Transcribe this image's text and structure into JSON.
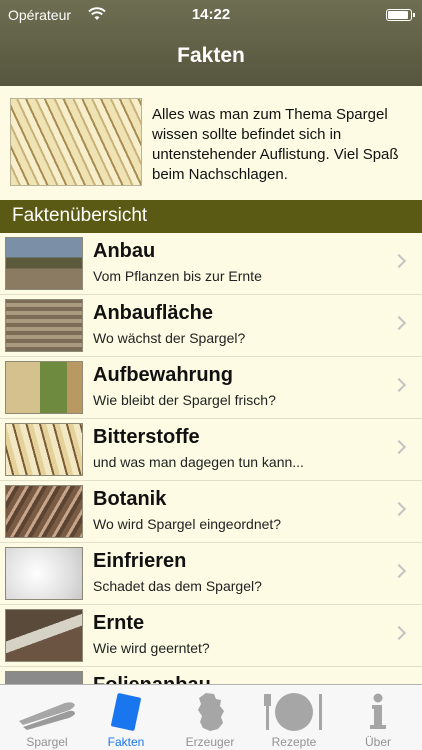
{
  "status_bar": {
    "carrier": "Opérateur",
    "time": "14:22"
  },
  "nav": {
    "title": "Fakten"
  },
  "intro": {
    "text": "Alles was man zum Thema Spargel wissen sollte befindet sich in untenstehender Auflistung. Viel Spaß beim Nachschlagen."
  },
  "section": {
    "title": "Faktenübersicht"
  },
  "items": [
    {
      "title": "Anbau",
      "subtitle": "Vom Pflanzen bis zur Ernte"
    },
    {
      "title": "Anbaufläche",
      "subtitle": "Wo wächst der Spargel?"
    },
    {
      "title": "Aufbewahrung",
      "subtitle": "Wie bleibt der Spargel frisch?"
    },
    {
      "title": "Bitterstoffe",
      "subtitle": "und was man dagegen tun kann..."
    },
    {
      "title": "Botanik",
      "subtitle": "Wo wird Spargel eingeordnet?"
    },
    {
      "title": "Einfrieren",
      "subtitle": "Schadet das dem Spargel?"
    },
    {
      "title": "Ernte",
      "subtitle": "Wie wird geerntet?"
    },
    {
      "title": "Folienanbau",
      "subtitle": ""
    }
  ],
  "tabs": [
    {
      "label": "Spargel",
      "icon": "asparagus-icon",
      "active": false
    },
    {
      "label": "Fakten",
      "icon": "book-icon",
      "active": true
    },
    {
      "label": "Erzeuger",
      "icon": "germany-map-icon",
      "active": false
    },
    {
      "label": "Rezepte",
      "icon": "plate-cutlery-icon",
      "active": false
    },
    {
      "label": "Über",
      "icon": "info-icon",
      "active": false
    }
  ],
  "colors": {
    "nav_bar": "#5f5f47",
    "section_header": "#5b5a14",
    "background": "#fdfbe4",
    "tab_active": "#1a76ee",
    "tab_inactive": "#929292"
  }
}
